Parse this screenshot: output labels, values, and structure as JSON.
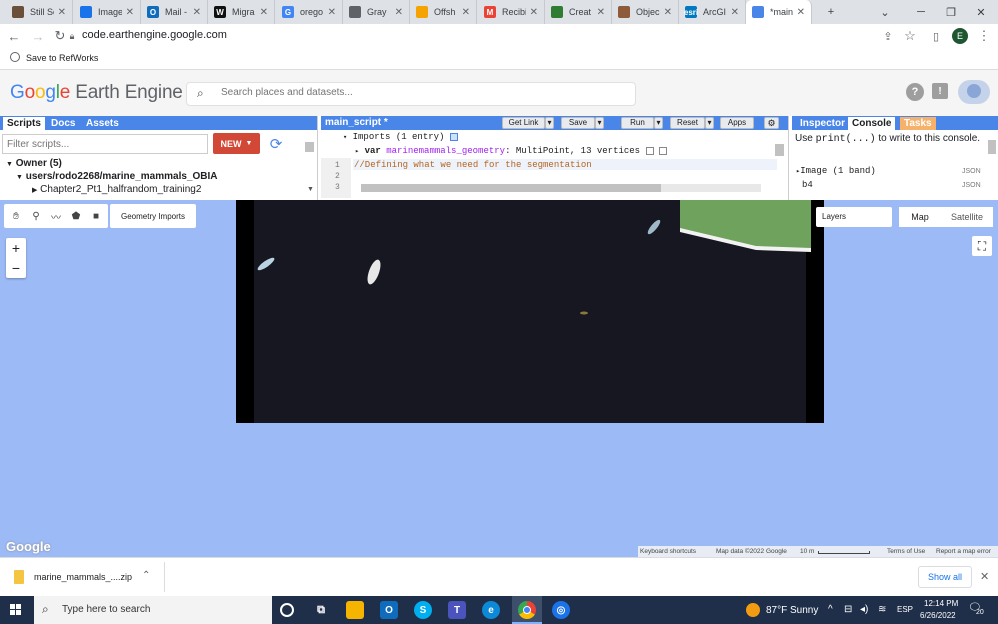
{
  "browser": {
    "tabs": [
      {
        "label": "Still Sc",
        "favicon_color": "#6a4f3a"
      },
      {
        "label": "Image",
        "favicon_color": "#1a73e8"
      },
      {
        "label": "Mail -",
        "favicon_color": "#0f6cbd"
      },
      {
        "label": "Migra",
        "favicon_color": "#111111"
      },
      {
        "label": "orego",
        "favicon_color": "#4285f4"
      },
      {
        "label": "Gray",
        "favicon_color": "#5f6368"
      },
      {
        "label": "Offsh",
        "favicon_color": "#f4a300"
      },
      {
        "label": "Recibi",
        "favicon_color": "#ea4335"
      },
      {
        "label": "Creat",
        "favicon_color": "#2e7d32"
      },
      {
        "label": "Objec",
        "favicon_color": "#8d5a3a"
      },
      {
        "label": "ArcGI",
        "favicon_color": "#0079c1"
      },
      {
        "label": "*main",
        "favicon_color": "#4a86e8"
      }
    ],
    "favicon_letters": [
      "",
      "",
      "O",
      "W",
      "G",
      "",
      "",
      "M",
      "",
      "",
      "esri",
      ""
    ],
    "url": "code.earthengine.google.com",
    "bookmark": "Save to RefWorks",
    "profile_initial": "E"
  },
  "gee": {
    "logo_google": "Google",
    "logo_rest": "Earth Engine",
    "search_placeholder": "Search places and datasets...",
    "left_tabs": [
      "Scripts",
      "Docs",
      "Assets"
    ],
    "filter_placeholder": "Filter scripts...",
    "new_button": "NEW",
    "tree": {
      "owner": "Owner (5)",
      "repo": "users/rodo2268/marine_mammals_OBIA",
      "file": "Chapter2_Pt1_halfrandom_training2"
    },
    "editor": {
      "script_name": "main_script *",
      "buttons": {
        "get_link": "Get Link",
        "save": "Save",
        "run": "Run",
        "reset": "Reset",
        "apps": "Apps"
      },
      "imports_header": "Imports (1 entry)",
      "import_line_kw": "var",
      "import_line_name": "marinemammals_geometry",
      "import_line_type": ": MultiPoint, 13 vertices",
      "line_numbers": [
        "1",
        "2",
        "3"
      ],
      "line1": "//Defining what we need for the segmentation"
    },
    "right_tabs": [
      "Inspector",
      "Console",
      "Tasks"
    ],
    "console": {
      "hint_pre": "Use ",
      "hint_code": "print(...)",
      "hint_post": " to write to this console.",
      "item1": "Image (1 band)",
      "item2": "b4",
      "json_label": "JSON"
    },
    "map": {
      "geometry_imports": "Geometry Imports",
      "layers": "Layers",
      "map_btn": "Map",
      "satellite_btn": "Satellite",
      "zoom_in": "+",
      "zoom_out": "−",
      "google_watermark": "Google",
      "footer": {
        "shortcuts": "Keyboard shortcuts",
        "data": "Map data ©2022 Google",
        "scale": "10 m",
        "terms": "Terms of Use",
        "report": "Report a map error"
      }
    }
  },
  "downloads": {
    "file": "marine_mammals_....zip",
    "show_all": "Show all"
  },
  "taskbar": {
    "search_placeholder": "Type here to search",
    "weather": "87°F  Sunny",
    "lang": "ESP",
    "time": "12:14 PM",
    "date": "6/26/2022",
    "notifications": "20"
  },
  "colors": {
    "gee_blue": "#4a86e8",
    "new_red": "#d14836",
    "tasks_orange": "#f6b26b",
    "map_water": "#9cbaf6"
  }
}
